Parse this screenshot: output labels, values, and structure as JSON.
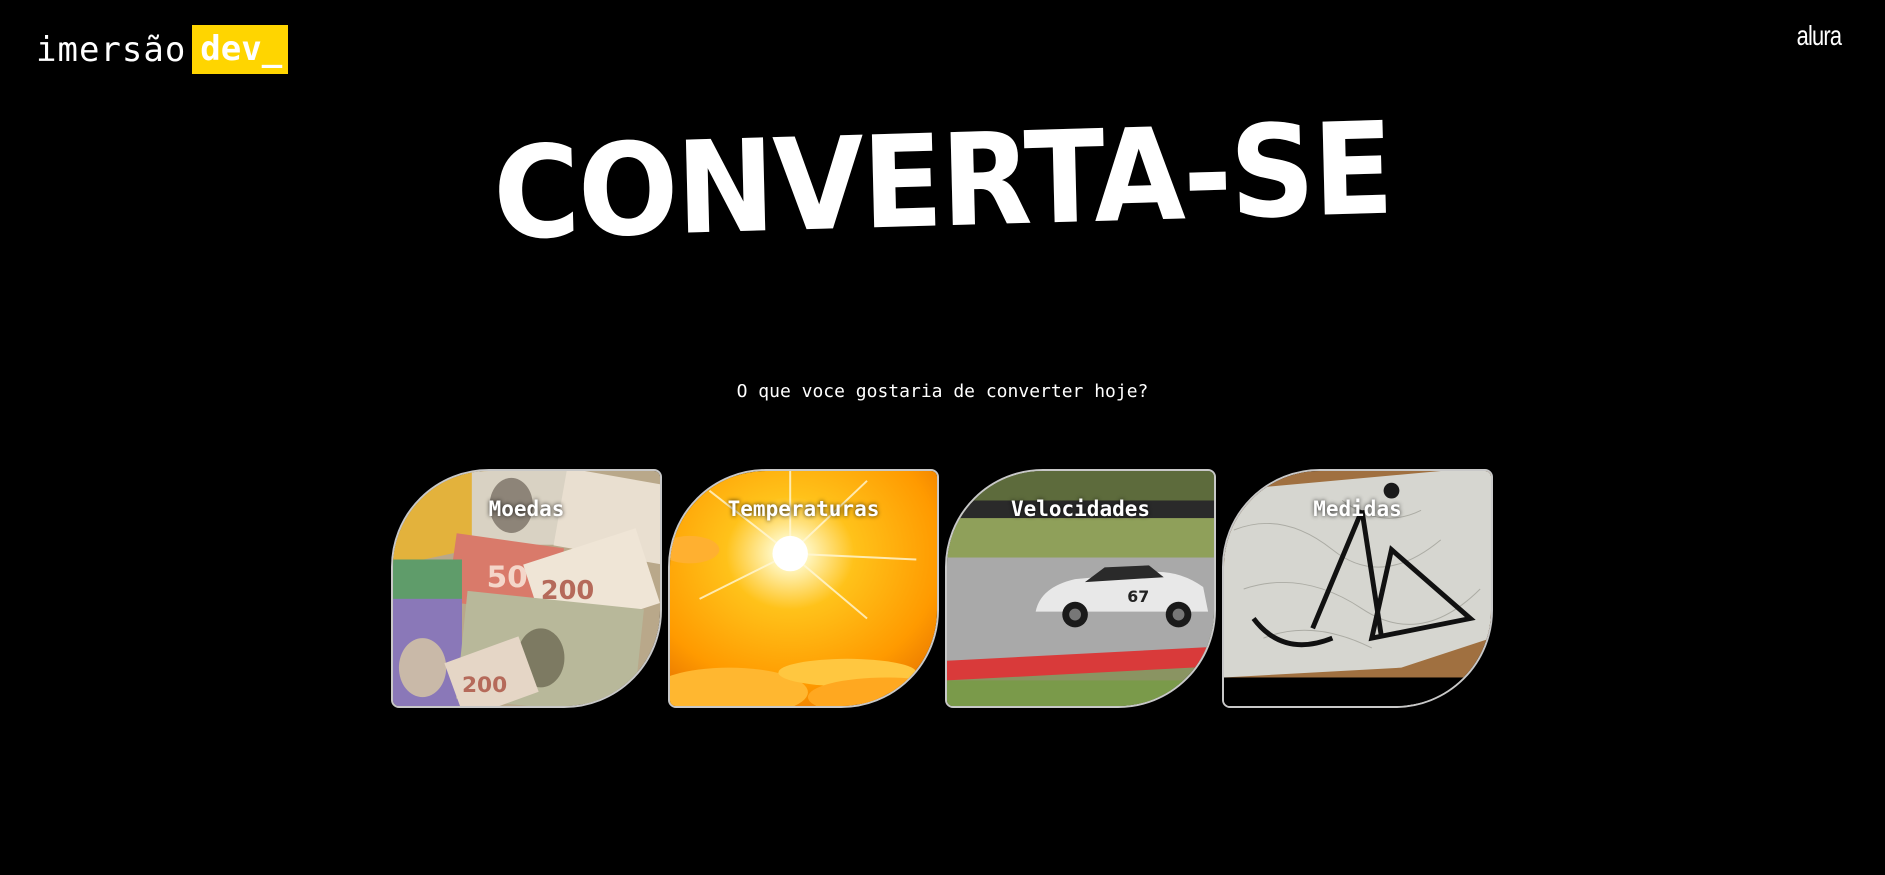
{
  "header": {
    "logo_text": "imersão",
    "logo_badge": "dev_",
    "brand": "alura"
  },
  "main": {
    "title": "CONVERTA-SE",
    "subtitle": "O que voce gostaria de converter hoje?"
  },
  "cards": [
    {
      "label": "Moedas",
      "image": "banknotes-icon"
    },
    {
      "label": "Temperaturas",
      "image": "sun-icon"
    },
    {
      "label": "Velocidades",
      "image": "race-car-icon"
    },
    {
      "label": "Medidas",
      "image": "drafting-tools-icon"
    }
  ],
  "colors": {
    "background": "#000000",
    "accent": "#ffd500",
    "text": "#ffffff"
  }
}
